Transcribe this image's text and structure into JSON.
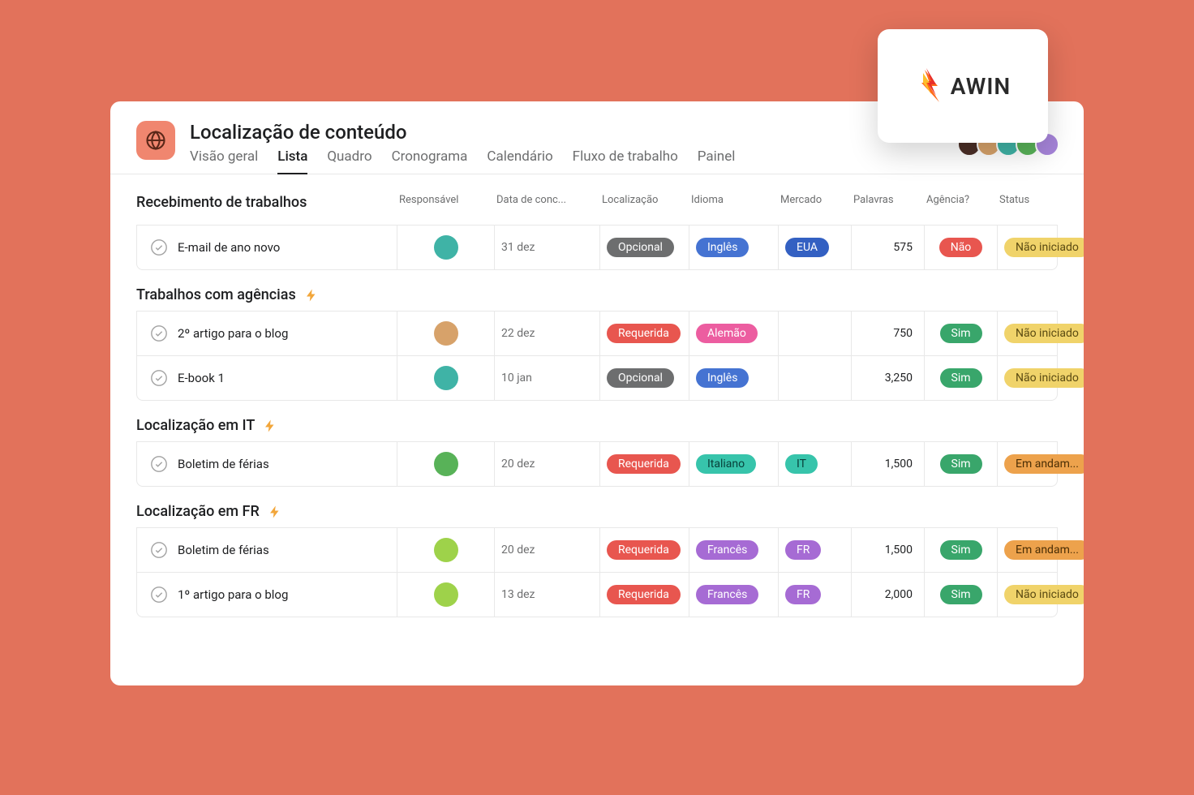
{
  "project": {
    "title": "Localização de conteúdo",
    "tabs": [
      "Visão geral",
      "Lista",
      "Quadro",
      "Cronograma",
      "Calendário",
      "Fluxo de trabalho",
      "Painel"
    ],
    "active_tab_index": 1
  },
  "awin": {
    "label": "AWIN"
  },
  "header_avatars": [
    {
      "bg": "#4c2f27"
    },
    {
      "bg": "#d7a26a"
    },
    {
      "bg": "#3fb3a6"
    },
    {
      "bg": "#58b258"
    },
    {
      "bg": "#a684d9"
    }
  ],
  "columns": [
    "Responsável",
    "Data de conc...",
    "Localização",
    "Idioma",
    "Mercado",
    "Palavras",
    "Agência?",
    "Status"
  ],
  "pill_colors": {
    "Opcional": "gray",
    "Requerida": "red",
    "Inglês": "blue",
    "Alemão": "pink",
    "Italiano": "teal",
    "Francês": "purple",
    "EUA": "blue-dark",
    "IT": "teal",
    "FR": "purple",
    "Não": "red",
    "Sim": "green",
    "Não iniciado": "yellow",
    "Em andam...": "orange"
  },
  "sections": [
    {
      "title": "Recebimento de trabalhos",
      "bolt": false,
      "rows": [
        {
          "name": "E-mail de ano novo",
          "assignee_bg": "#3fb3a6",
          "date": "31 dez",
          "loc": "Opcional",
          "lang": "Inglês",
          "market": "EUA",
          "words": "575",
          "agency": "Não",
          "status": "Não iniciado"
        }
      ]
    },
    {
      "title": "Trabalhos com agências",
      "bolt": true,
      "rows": [
        {
          "name": "2º artigo para o blog",
          "assignee_bg": "#d7a26a",
          "date": "22 dez",
          "loc": "Requerida",
          "lang": "Alemão",
          "market": "",
          "words": "750",
          "agency": "Sim",
          "status": "Não iniciado"
        },
        {
          "name": "E-book 1",
          "assignee_bg": "#3fb3a6",
          "date": "10 jan",
          "loc": "Opcional",
          "lang": "Inglês",
          "market": "",
          "words": "3,250",
          "agency": "Sim",
          "status": "Não iniciado"
        }
      ]
    },
    {
      "title": "Localização em IT",
      "bolt": true,
      "rows": [
        {
          "name": "Boletim de férias",
          "assignee_bg": "#58b258",
          "date": "20 dez",
          "loc": "Requerida",
          "lang": "Italiano",
          "market": "IT",
          "words": "1,500",
          "agency": "Sim",
          "status": "Em andam..."
        }
      ]
    },
    {
      "title": "Localização em FR",
      "bolt": true,
      "rows": [
        {
          "name": "Boletim de férias",
          "assignee_bg": "#9ed24a",
          "date": "20 dez",
          "loc": "Requerida",
          "lang": "Francês",
          "market": "FR",
          "words": "1,500",
          "agency": "Sim",
          "status": "Em andam..."
        },
        {
          "name": "1º artigo para o blog",
          "assignee_bg": "#9ed24a",
          "date": "13 dez",
          "loc": "Requerida",
          "lang": "Francês",
          "market": "FR",
          "words": "2,000",
          "agency": "Sim",
          "status": "Não iniciado"
        }
      ]
    }
  ]
}
